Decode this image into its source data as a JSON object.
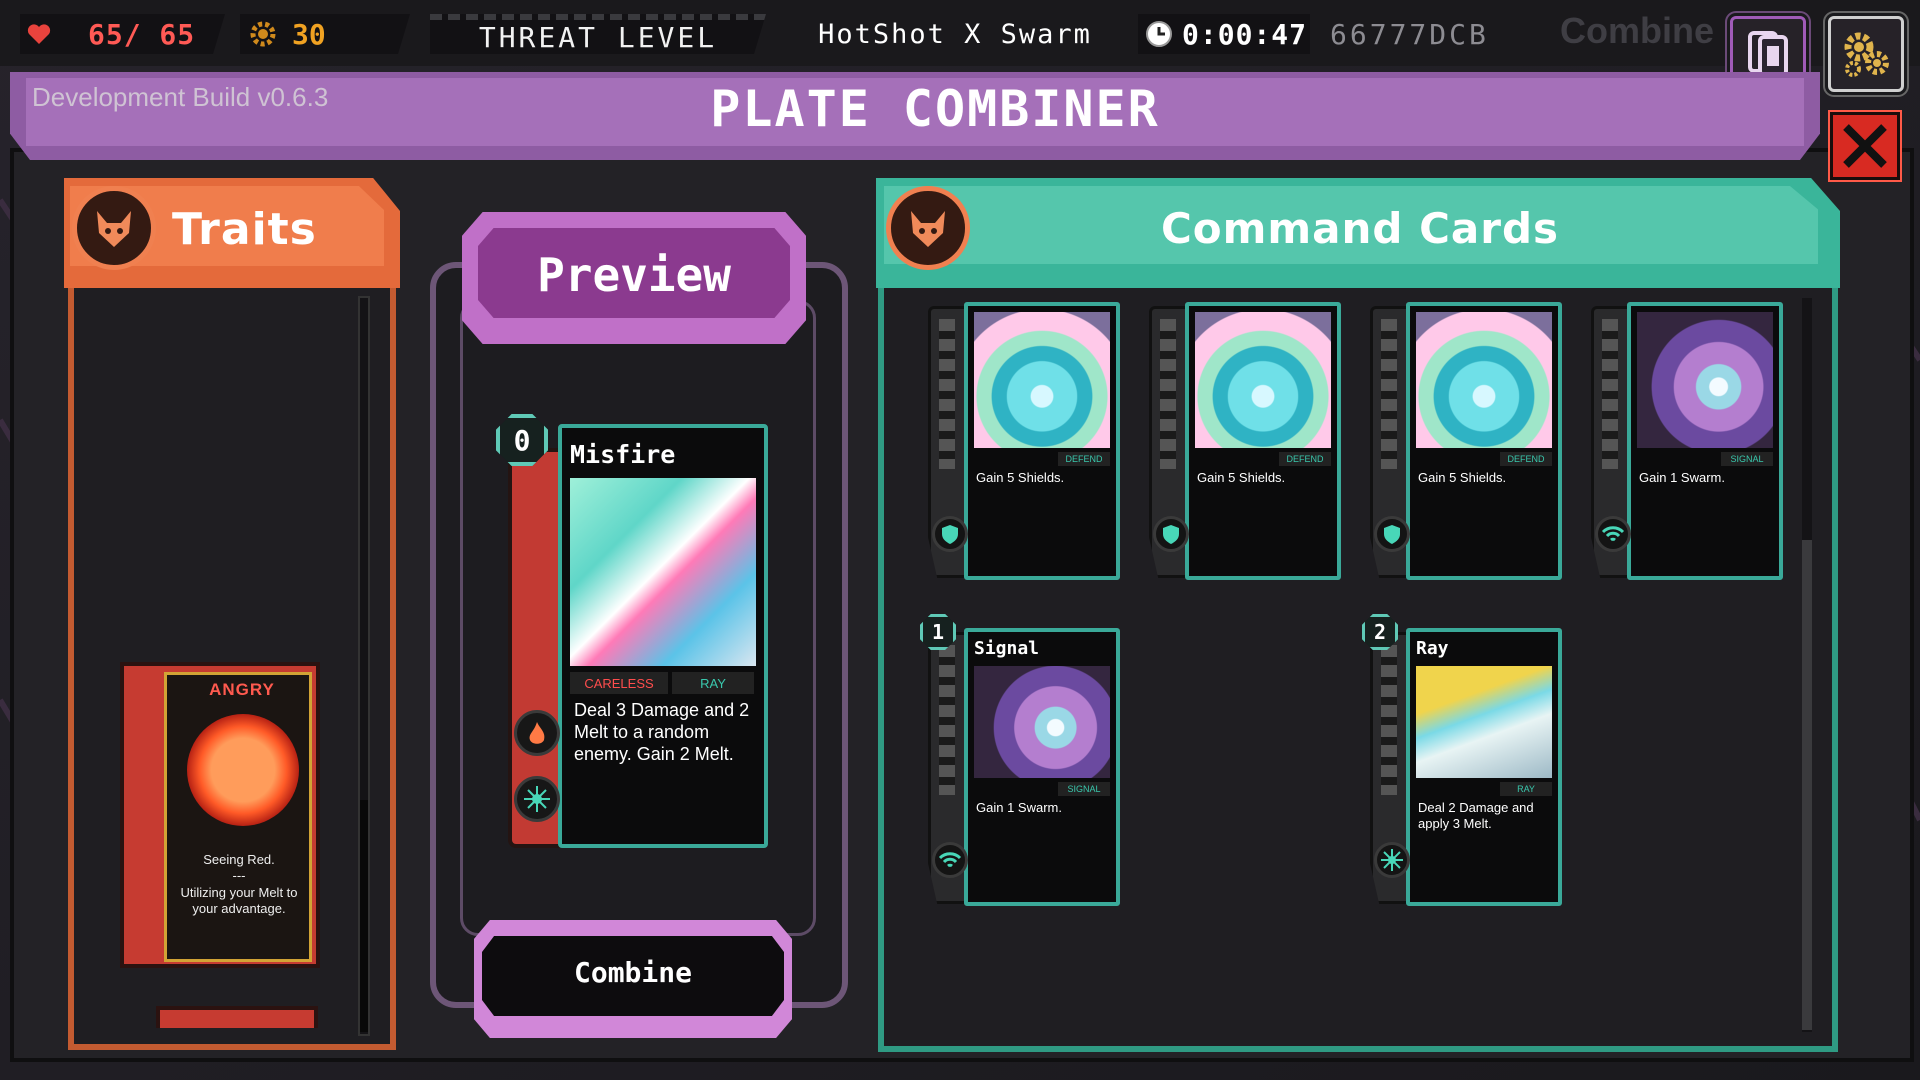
{
  "hud": {
    "hp": "65/ 65",
    "gold": "30",
    "threat_label": "THREAT LEVEL",
    "mode": "HotShot X Swarm",
    "timer": "0:00:47",
    "seed": "66777DCB",
    "ghost_label": "Combine"
  },
  "header": {
    "dev_build": "Development Build v0.6.3",
    "title": "PLATE COMBINER"
  },
  "traits": {
    "title": "Traits",
    "card": {
      "name": "ANGRY",
      "description_line1": "Seeing Red.",
      "description_line2": "---",
      "description_line3": "Utilizing your Melt to your advantage."
    }
  },
  "preview": {
    "title": "Preview",
    "card": {
      "cost": "0",
      "name": "Misfire",
      "tag_left": "CARELESS",
      "tag_right": "RAY",
      "description": "Deal 3 Damage and 2 Melt to a random enemy. Gain 2 Melt."
    },
    "combine_label": "Combine"
  },
  "command_cards": {
    "title": "Command Cards",
    "cards": [
      {
        "cost": "",
        "name": "",
        "tag": "DEFEND",
        "description": "Gain 5 Shields.",
        "art": "shield",
        "icon": "shield-icon"
      },
      {
        "cost": "",
        "name": "",
        "tag": "DEFEND",
        "description": "Gain 5 Shields.",
        "art": "shield",
        "icon": "shield-icon"
      },
      {
        "cost": "",
        "name": "",
        "tag": "DEFEND",
        "description": "Gain 5 Shields.",
        "art": "shield",
        "icon": "shield-icon"
      },
      {
        "cost": "",
        "name": "",
        "tag": "SIGNAL",
        "description": "Gain 1 Swarm.",
        "art": "signal",
        "icon": "wifi-icon"
      },
      {
        "cost": "1",
        "name": "Signal",
        "tag": "SIGNAL",
        "description": "Gain 1 Swarm.",
        "art": "signal",
        "icon": "wifi-icon"
      },
      {
        "cost": "2",
        "name": "Ray",
        "tag": "RAY",
        "description": "Deal 2 Damage and apply 3 Melt.",
        "art": "ray",
        "icon": "burst-icon"
      }
    ]
  },
  "colors": {
    "traits_accent": "#f07d4c",
    "preview_accent": "#c070c8",
    "command_accent": "#55c6ac",
    "hp_red": "#ff5a55",
    "gold": "#f0a222"
  }
}
